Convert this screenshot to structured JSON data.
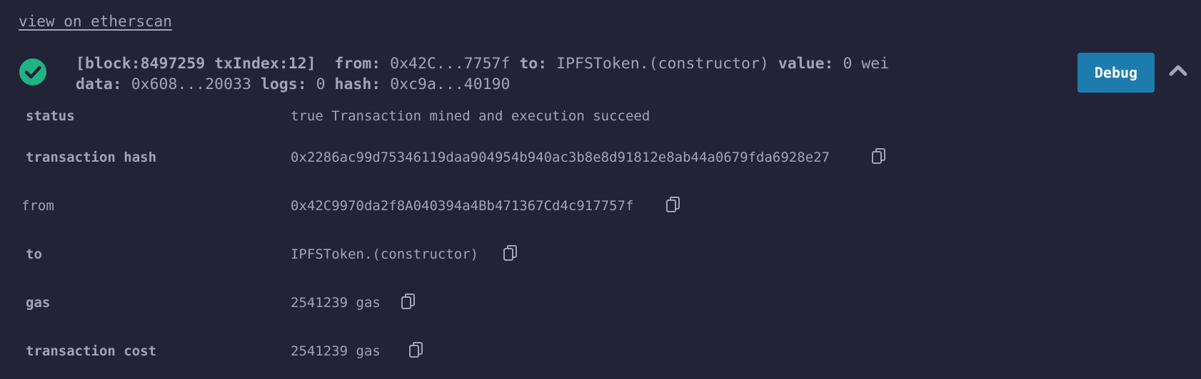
{
  "link": {
    "etherscan": "view on etherscan"
  },
  "summary": {
    "block_text": "[block:8497259 txIndex:12]",
    "from_label": "from:",
    "from_value": "0x42C...7757f",
    "to_label": "to:",
    "to_value": "IPFSToken.(constructor)",
    "value_label": "value:",
    "value_value": "0 wei",
    "data_label": "data:",
    "data_value": "0x608...20033",
    "logs_label": "logs:",
    "logs_value": "0",
    "hash_label": "hash:",
    "hash_value": "0xc9a...40190"
  },
  "buttons": {
    "debug": "Debug"
  },
  "rows": [
    {
      "label": "status",
      "value": "true Transaction mined and execution succeed"
    },
    {
      "label": "transaction hash",
      "value": "0x2286ac99d75346119daa904954b940ac3b8e8d91812e8ab44a0679fda6928e27"
    },
    {
      "label": "from",
      "value": "0x42C9970da2f8A040394a4Bb471367Cd4c917757f"
    },
    {
      "label": "to",
      "value": "IPFSToken.(constructor)"
    },
    {
      "label": "gas",
      "value": "2541239 gas"
    },
    {
      "label": "transaction cost",
      "value": "2541239 gas"
    }
  ],
  "icons": {
    "status": "check-circle-icon",
    "copy": "copy-icon",
    "collapse": "chevron-up-icon"
  },
  "colors": {
    "background": "#222336",
    "text": "#a2a3bd",
    "success": "#1fb386",
    "debug_button": "#1d7cae"
  }
}
